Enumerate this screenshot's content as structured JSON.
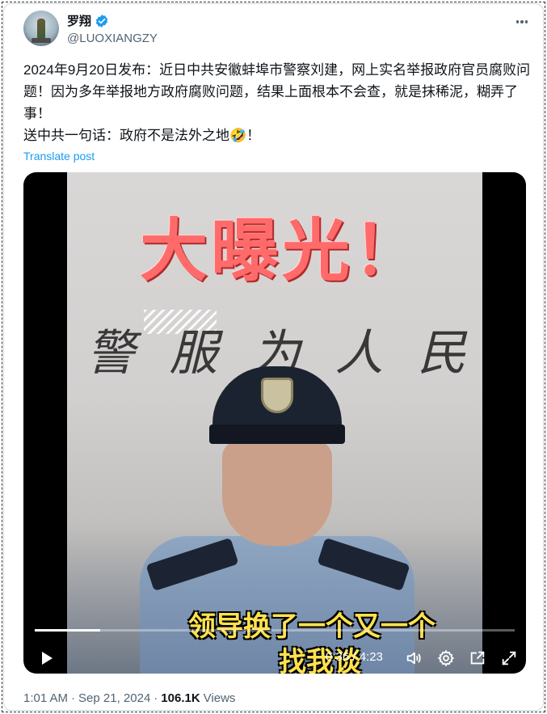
{
  "author": {
    "name": "罗翔",
    "handle": "@LUOXIANGZY",
    "verified": true
  },
  "post": {
    "text": "2024年9月20日发布：近日中共安徽蚌埠市警察刘建，网上实名举报政府官员腐败问题！因为多年举报地方政府腐败问题，结果上面根本不会查，就是抹稀泥，糊弄了事！\n送中共一句话：政府不是法外之地🤣！",
    "translate_label": "Translate post"
  },
  "video": {
    "banner": "大曝光！",
    "calligraphy": [
      "警",
      "服",
      "为",
      "人",
      "民"
    ],
    "subtitle_line1": "领导换了一个又一个",
    "subtitle_line2": "找我谈",
    "current_time": "0:36",
    "duration": "4:23",
    "time_display": "0:36 / 4:23",
    "progress": 0.137
  },
  "footer": {
    "time": "1:01 AM",
    "date": "Sep 21, 2024",
    "views_count": "106.1K",
    "views_label": "Views"
  },
  "icons": {
    "more": "more-icon",
    "play": "play-icon",
    "volume": "volume-icon",
    "settings": "settings-icon",
    "pip": "pip-icon",
    "fullscreen": "fullscreen-icon"
  },
  "colors": {
    "link": "#1d9bf0",
    "secondary_text": "#536471",
    "subtitle": "#ffe24d"
  }
}
